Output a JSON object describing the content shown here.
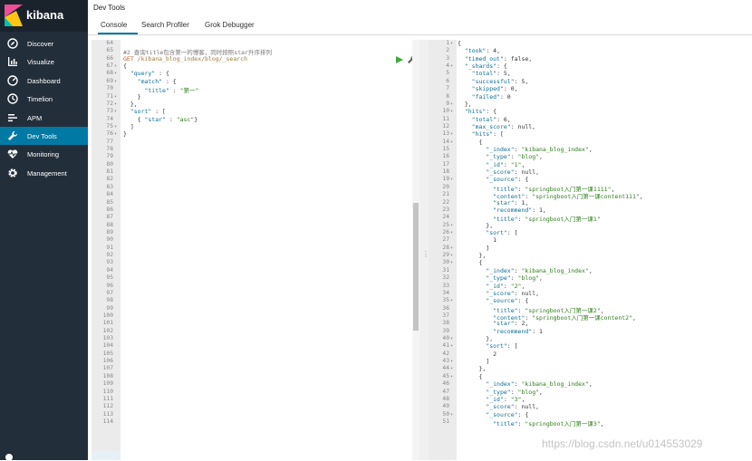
{
  "brand": {
    "name": "kibana"
  },
  "sidebar": {
    "items": [
      {
        "label": "Discover",
        "icon": "compass-icon"
      },
      {
        "label": "Visualize",
        "icon": "bar-chart-icon"
      },
      {
        "label": "Dashboard",
        "icon": "dashboard-icon"
      },
      {
        "label": "Timelion",
        "icon": "timelion-icon"
      },
      {
        "label": "APM",
        "icon": "apm-icon"
      },
      {
        "label": "Dev Tools",
        "icon": "wrench-icon",
        "active": true
      },
      {
        "label": "Monitoring",
        "icon": "heartbeat-icon"
      },
      {
        "label": "Management",
        "icon": "gear-icon"
      }
    ]
  },
  "header": {
    "title": "Dev Tools",
    "tabs": [
      {
        "label": "Console"
      },
      {
        "label": "Search Profiler"
      },
      {
        "label": "Grok Debugger"
      }
    ]
  },
  "request": {
    "first_line_number": "64",
    "lines": [
      {
        "n": "65",
        "t": "#2 查询title包含第一的博客，同时按照star升序排列",
        "kind": "comment"
      },
      {
        "n": "66",
        "t": "GET /kibana_blog_index/blog/_search",
        "kind": "method"
      },
      {
        "n": "67",
        "t": "{",
        "fold": true
      },
      {
        "n": "68",
        "t": "  \"query\" : {",
        "fold": true
      },
      {
        "n": "69",
        "t": "    \"match\" : {",
        "fold": true
      },
      {
        "n": "70",
        "t": "      \"title\" : \"第一\""
      },
      {
        "n": "71",
        "t": "    }",
        "fold": true
      },
      {
        "n": "72",
        "t": "  },",
        "fold": true
      },
      {
        "n": "73",
        "t": "  \"sort\" : [",
        "fold": true
      },
      {
        "n": "74",
        "t": "    { \"star\" : \"asc\"}"
      },
      {
        "n": "75",
        "t": "  ]",
        "fold": true
      },
      {
        "n": "76",
        "t": "}",
        "fold": true
      }
    ],
    "empty_lines": [
      "77",
      "78",
      "79",
      "80",
      "81",
      "82",
      "83",
      "84",
      "85",
      "86",
      "87",
      "88",
      "89",
      "90",
      "91",
      "92",
      "93",
      "94",
      "95",
      "96",
      "97",
      "98",
      "99",
      "100",
      "101",
      "102",
      "103",
      "104",
      "105",
      "106",
      "107",
      "108",
      "109",
      "110",
      "111",
      "112",
      "113",
      "114"
    ]
  },
  "response": {
    "lines": [
      {
        "n": "1",
        "t": "{",
        "fold": true
      },
      {
        "n": "2",
        "t": "  \"took\": 4,"
      },
      {
        "n": "3",
        "t": "  \"timed_out\": false,"
      },
      {
        "n": "4",
        "t": "  \"_shards\": {",
        "fold": true
      },
      {
        "n": "5",
        "t": "    \"total\": 5,"
      },
      {
        "n": "6",
        "t": "    \"successful\": 5,"
      },
      {
        "n": "7",
        "t": "    \"skipped\": 0,"
      },
      {
        "n": "8",
        "t": "    \"failed\": 0"
      },
      {
        "n": "9",
        "t": "  },",
        "fold": true
      },
      {
        "n": "10",
        "t": "  \"hits\": {",
        "fold": true
      },
      {
        "n": "11",
        "t": "    \"total\": 6,"
      },
      {
        "n": "12",
        "t": "    \"max_score\": null,"
      },
      {
        "n": "13",
        "t": "    \"hits\": [",
        "fold": true
      },
      {
        "n": "14",
        "t": "      {",
        "fold": true
      },
      {
        "n": "15",
        "t": "        \"_index\": \"kibana_blog_index\","
      },
      {
        "n": "16",
        "t": "        \"_type\": \"blog\","
      },
      {
        "n": "17",
        "t": "        \"_id\": \"1\","
      },
      {
        "n": "18",
        "t": "        \"_score\": null,"
      },
      {
        "n": "19",
        "t": "        \"_source\": {",
        "fold": true
      },
      {
        "n": "20",
        "t": "          \"title\": \"springboot入门第一课1111\","
      },
      {
        "n": "21",
        "t": "          \"content\": \"springboot入门第一课content111\","
      },
      {
        "n": "22",
        "t": "          \"star\": 1,"
      },
      {
        "n": "23",
        "t": "          \"recommend\": 1,"
      },
      {
        "n": "24",
        "t": "          \"title\": \"springboot入门第一课1\""
      },
      {
        "n": "25",
        "t": "        },",
        "fold": true
      },
      {
        "n": "26",
        "t": "        \"sort\": [",
        "fold": true
      },
      {
        "n": "27",
        "t": "          1"
      },
      {
        "n": "28",
        "t": "        ]",
        "fold": true
      },
      {
        "n": "29",
        "t": "      },",
        "fold": true
      },
      {
        "n": "30",
        "t": "      {",
        "fold": true
      },
      {
        "n": "31",
        "t": "        \"_index\": \"kibana_blog_index\","
      },
      {
        "n": "32",
        "t": "        \"_type\": \"blog\","
      },
      {
        "n": "33",
        "t": "        \"_id\": \"2\","
      },
      {
        "n": "34",
        "t": "        \"_score\": null,"
      },
      {
        "n": "35",
        "t": "        \"_source\": {",
        "fold": true
      },
      {
        "n": "36",
        "t": "          \"title\": \"springboot入门第一课2\","
      },
      {
        "n": "37",
        "t": "          \"content\": \"springboot入门第一课content2\","
      },
      {
        "n": "38",
        "t": "          \"star\": 2,"
      },
      {
        "n": "39",
        "t": "          \"recommend\": 1"
      },
      {
        "n": "40",
        "t": "        },",
        "fold": true
      },
      {
        "n": "41",
        "t": "        \"sort\": [",
        "fold": true
      },
      {
        "n": "42",
        "t": "          2"
      },
      {
        "n": "43",
        "t": "        ]",
        "fold": true
      },
      {
        "n": "44",
        "t": "      },",
        "fold": true
      },
      {
        "n": "45",
        "t": "      {",
        "fold": true
      },
      {
        "n": "46",
        "t": "        \"_index\": \"kibana_blog_index\","
      },
      {
        "n": "47",
        "t": "        \"_type\": \"blog\","
      },
      {
        "n": "48",
        "t": "        \"_id\": \"3\","
      },
      {
        "n": "49",
        "t": "        \"_score\": null,"
      },
      {
        "n": "50",
        "t": "        \"_source\": {",
        "fold": true
      },
      {
        "n": "51",
        "t": "          \"title\": \"springboot入门第一课3\","
      }
    ]
  },
  "watermark": "https://blog.csdn.net/u014553029",
  "colors": {
    "sidebar": "#222e3a",
    "active": "#0079a5",
    "key": "#0d6e95",
    "string": "#2d7d1a",
    "run": "#3caa3c"
  }
}
